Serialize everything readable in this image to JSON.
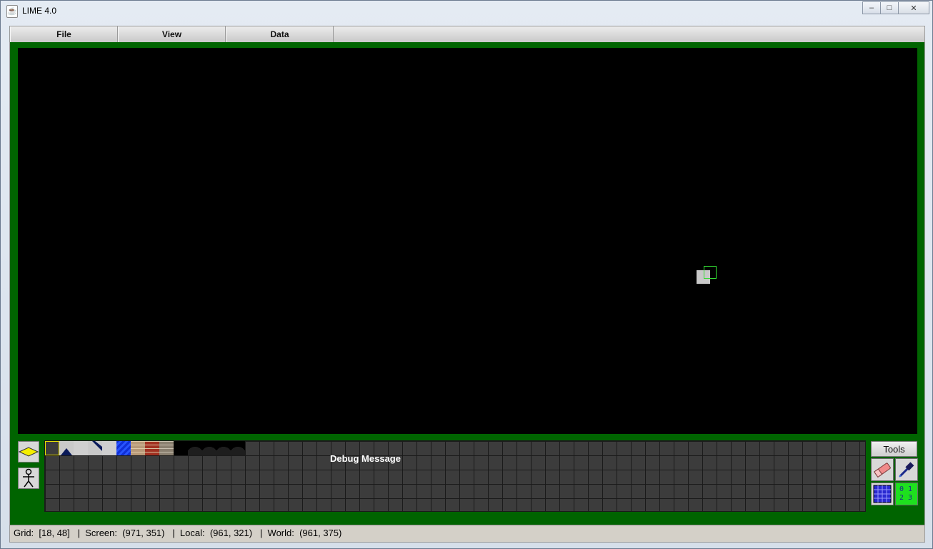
{
  "window": {
    "title": "LIME 4.0",
    "controls": {
      "minimize": "‒",
      "maximize": "□",
      "close": "✕"
    }
  },
  "menu": {
    "items": [
      {
        "label": "File"
      },
      {
        "label": "View"
      },
      {
        "label": "Data"
      }
    ]
  },
  "palette": {
    "debug_message": "Debug Message",
    "tiles": [
      "empty-selected",
      "grey-arrow-up",
      "grey-blank",
      "grey-chevron-down",
      "blue-water",
      "brick-beige",
      "brick-red",
      "brick-grey",
      "black-dome",
      "black-dome",
      "black-dome",
      "black-dome"
    ]
  },
  "tools": {
    "label": "Tools",
    "items": [
      "eraser-icon",
      "eyedropper-icon",
      "grid-icon",
      "numbered-grid-icon"
    ],
    "numbered_grid_digits": [
      "0",
      "1",
      "2",
      "3"
    ]
  },
  "left_tools": [
    "layer-diamond-icon",
    "stick-figure-icon"
  ],
  "status": {
    "text": "Grid:  [18, 48]   |  Screen:  (971, 351)   |  Local:  (961, 321)   |  World:  (961, 375)"
  },
  "colors": {
    "workspace_green": "#006400",
    "canvas": "#000000",
    "palette_bg": "#3c3c3c",
    "selection_yellow": "#e8e000",
    "cursor_outline": "#33dd33"
  }
}
